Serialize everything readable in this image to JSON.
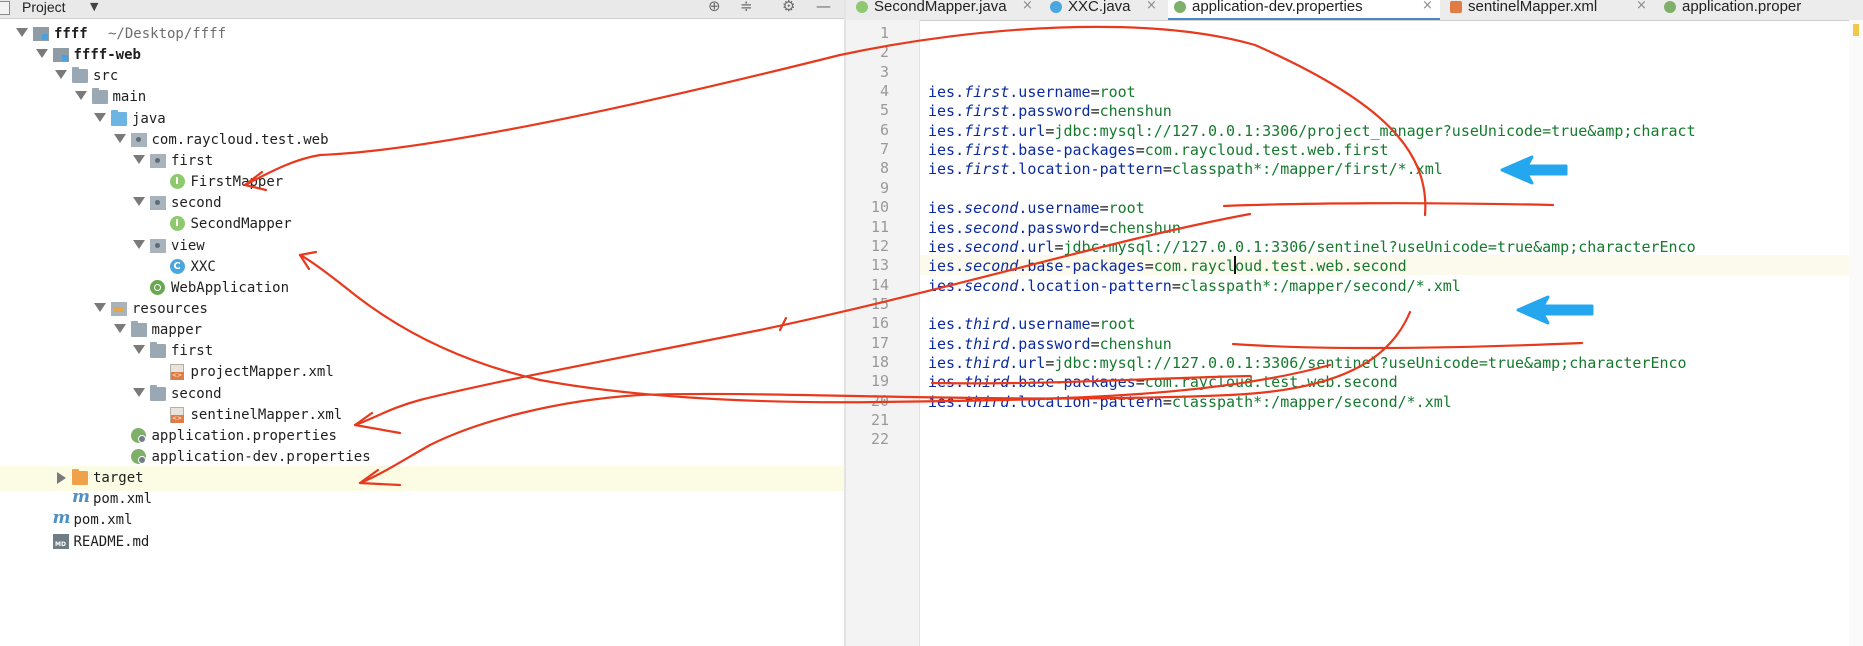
{
  "project_panel": {
    "title": "Project",
    "tree": [
      {
        "label": "ffff",
        "hint": "~/Desktop/ffff",
        "icon": "module-folder-icon",
        "depth": 0,
        "arrow": "down",
        "bold": true
      },
      {
        "label": "ffff-web",
        "icon": "module-folder-icon",
        "depth": 1,
        "arrow": "down",
        "bold": true
      },
      {
        "label": "src",
        "icon": "folder-icon",
        "depth": 2,
        "arrow": "down"
      },
      {
        "label": "main",
        "icon": "folder-icon",
        "depth": 3,
        "arrow": "down"
      },
      {
        "label": "java",
        "icon": "source-folder-icon",
        "depth": 4,
        "arrow": "down"
      },
      {
        "label": "com.raycloud.test.web",
        "icon": "package-icon",
        "depth": 5,
        "arrow": "down"
      },
      {
        "label": "first",
        "icon": "package-icon",
        "depth": 6,
        "arrow": "down"
      },
      {
        "label": "FirstMapper",
        "icon": "interface-icon",
        "depth": 7,
        "arrow": "none"
      },
      {
        "label": "second",
        "icon": "package-icon",
        "depth": 6,
        "arrow": "down"
      },
      {
        "label": "SecondMapper",
        "icon": "interface-icon",
        "depth": 7,
        "arrow": "none"
      },
      {
        "label": "view",
        "icon": "package-icon",
        "depth": 6,
        "arrow": "down"
      },
      {
        "label": "XXC",
        "icon": "class-icon",
        "depth": 7,
        "arrow": "none"
      },
      {
        "label": "WebApplication",
        "icon": "spring-class-icon",
        "depth": 6,
        "arrow": "none"
      },
      {
        "label": "resources",
        "icon": "resources-folder-icon",
        "depth": 4,
        "arrow": "down"
      },
      {
        "label": "mapper",
        "icon": "folder-icon",
        "depth": 5,
        "arrow": "down"
      },
      {
        "label": "first",
        "icon": "folder-icon",
        "depth": 6,
        "arrow": "down"
      },
      {
        "label": "projectMapper.xml",
        "icon": "xml-file-icon",
        "depth": 7,
        "arrow": "none"
      },
      {
        "label": "second",
        "icon": "folder-icon",
        "depth": 6,
        "arrow": "down"
      },
      {
        "label": "sentinelMapper.xml",
        "icon": "xml-file-icon",
        "depth": 7,
        "arrow": "none"
      },
      {
        "label": "application.properties",
        "icon": "spring-properties-icon",
        "depth": 5,
        "arrow": "none"
      },
      {
        "label": "application-dev.properties",
        "icon": "spring-properties-icon",
        "depth": 5,
        "arrow": "none"
      },
      {
        "label": "target",
        "icon": "excluded-folder-icon",
        "depth": 2,
        "arrow": "right",
        "selected": true
      },
      {
        "label": "pom.xml",
        "icon": "maven-pom-icon",
        "depth": 2,
        "arrow": "none"
      },
      {
        "label": "pom.xml",
        "icon": "maven-pom-icon",
        "depth": 1,
        "arrow": "none"
      },
      {
        "label": "README.md",
        "icon": "markdown-file-icon",
        "depth": 1,
        "arrow": "none"
      }
    ]
  },
  "editor": {
    "tabs": [
      {
        "label": "SecondMapper.java",
        "icon": "interface-icon",
        "active": false
      },
      {
        "label": "XXC.java",
        "icon": "class-icon",
        "active": false
      },
      {
        "label": "application-dev.properties",
        "icon": "spring-properties-icon",
        "active": true
      },
      {
        "label": "sentinelMapper.xml",
        "icon": "xml-file-icon",
        "active": false
      },
      {
        "label": "application.proper",
        "icon": "spring-properties-icon",
        "active": false
      }
    ],
    "current_line": 13,
    "lines": [
      {
        "n": "1",
        "key": "",
        "mid": "",
        "prop": "",
        "value": ""
      },
      {
        "n": "2",
        "key": "",
        "mid": "",
        "prop": "",
        "value": ""
      },
      {
        "n": "3",
        "key": "",
        "mid": "",
        "prop": "",
        "value": ""
      },
      {
        "n": "4",
        "key": "ies.",
        "mid": "first",
        "prop": ".username",
        "value": "root"
      },
      {
        "n": "5",
        "key": "ies.",
        "mid": "first",
        "prop": ".password",
        "value": "chenshun"
      },
      {
        "n": "6",
        "key": "ies.",
        "mid": "first",
        "prop": ".url",
        "value": "jdbc:mysql://127.0.0.1:3306/project_manager?useUnicode=true&amp;charact"
      },
      {
        "n": "7",
        "key": "ies.",
        "mid": "first",
        "prop": ".base-packages",
        "value": "com.raycloud.test.web.first"
      },
      {
        "n": "8",
        "key": "ies.",
        "mid": "first",
        "prop": ".location-pattern",
        "value": "classpath*:/mapper/first/*.xml"
      },
      {
        "n": "9",
        "key": "",
        "mid": "",
        "prop": "",
        "value": ""
      },
      {
        "n": "10",
        "key": "ies.",
        "mid": "second",
        "prop": ".username",
        "value": "root"
      },
      {
        "n": "11",
        "key": "ies.",
        "mid": "second",
        "prop": ".password",
        "value": "chenshun"
      },
      {
        "n": "12",
        "key": "ies.",
        "mid": "second",
        "prop": ".url",
        "value": "jdbc:mysql://127.0.0.1:3306/sentinel?useUnicode=true&amp;characterEnco"
      },
      {
        "n": "13",
        "key": "ies.",
        "mid": "second",
        "prop": ".base-packages",
        "value": "com.raycloud.test.web.second"
      },
      {
        "n": "14",
        "key": "ies.",
        "mid": "second",
        "prop": ".location-pattern",
        "value": "classpath*:/mapper/second/*.xml"
      },
      {
        "n": "15",
        "key": "",
        "mid": "",
        "prop": "",
        "value": ""
      },
      {
        "n": "16",
        "key": "ies.",
        "mid": "third",
        "prop": ".username",
        "value": "root"
      },
      {
        "n": "17",
        "key": "ies.",
        "mid": "third",
        "prop": ".password",
        "value": "chenshun"
      },
      {
        "n": "18",
        "key": "ies.",
        "mid": "third",
        "prop": ".url",
        "value": "jdbc:mysql://127.0.0.1:3306/sentinel?useUnicode=true&amp;characterEnco"
      },
      {
        "n": "19",
        "key": "ies.",
        "mid": "third",
        "prop": ".base-packages",
        "value": "com.raycloud.test.web.second"
      },
      {
        "n": "20",
        "key": "ies.",
        "mid": "third",
        "prop": ".location-pattern",
        "value": "classpath*:/mapper/second/*.xml"
      },
      {
        "n": "21",
        "key": "",
        "mid": "",
        "prop": "",
        "value": ""
      },
      {
        "n": "22",
        "key": "",
        "mid": "",
        "prop": "",
        "value": ""
      }
    ]
  },
  "colors": {
    "annotation_red": "#e8391d",
    "annotation_blue": "#25a7ef",
    "property_key": "#0b2aa0",
    "property_value": "#157a2e"
  }
}
